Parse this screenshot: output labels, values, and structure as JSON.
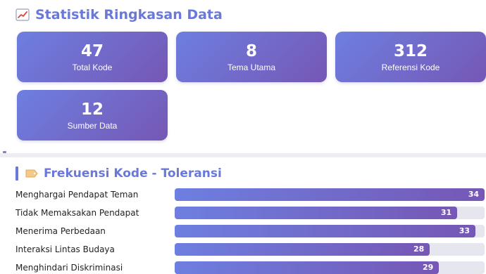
{
  "summary": {
    "title": "Statistik Ringkasan Data",
    "icon": "chart-increasing-icon",
    "cards": [
      {
        "value": "47",
        "label": "Total Kode"
      },
      {
        "value": "8",
        "label": "Tema Utama"
      },
      {
        "value": "312",
        "label": "Referensi Kode"
      },
      {
        "value": "12",
        "label": "Sumber Data"
      }
    ]
  },
  "frequency": {
    "title": "Frekuensi Kode - Toleransi",
    "icon": "label-tag-icon",
    "scale_max": 34,
    "items": [
      {
        "label": "Menghargai Pendapat Teman",
        "value": 34
      },
      {
        "label": "Tidak Memaksakan Pendapat",
        "value": 31
      },
      {
        "label": "Menerima Perbedaan",
        "value": 33
      },
      {
        "label": "Interaksi Lintas Budaya",
        "value": 28
      },
      {
        "label": "Menghindari Diskriminasi",
        "value": 29
      }
    ]
  },
  "colors": {
    "accent": "#6a78d8",
    "gradient_start": "#6d7fe0",
    "gradient_end": "#7657b5"
  }
}
